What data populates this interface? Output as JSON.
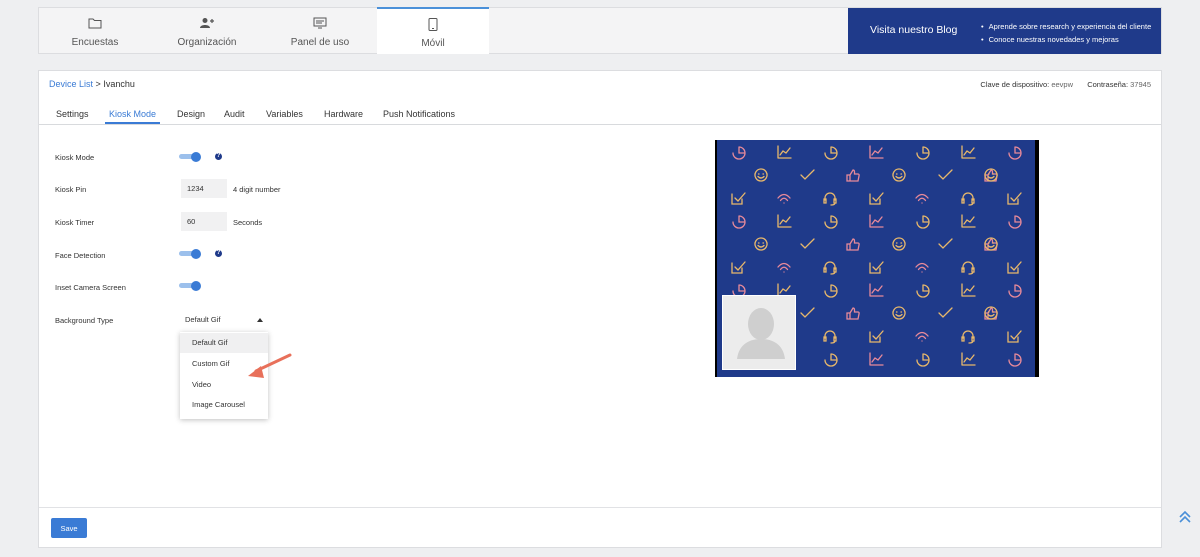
{
  "topnav": {
    "tabs": [
      {
        "label": "Encuestas",
        "icon": "folder-icon"
      },
      {
        "label": "Organización",
        "icon": "add-user-icon"
      },
      {
        "label": "Panel de uso",
        "icon": "dashboard-icon"
      },
      {
        "label": "Móvil",
        "icon": "mobile-icon",
        "active": true
      }
    ]
  },
  "blog": {
    "title": "Visita nuestro Blog",
    "bullets": [
      "Aprende sobre research y experiencia del cliente",
      "Conoce nuestras novedades y mejoras"
    ]
  },
  "breadcrumb": {
    "link": "Device List",
    "separator": ">",
    "current": "Ivanchu"
  },
  "credentials": {
    "device_key_label": "Clave de dispositivo:",
    "device_key_value": "eevpw",
    "password_label": "Contraseña:",
    "password_value": "37945"
  },
  "tabs": [
    "Settings",
    "Kiosk Mode",
    "Design",
    "Audit",
    "Variables",
    "Hardware",
    "Push Notifications"
  ],
  "active_tab": "Kiosk Mode",
  "form": {
    "kiosk_mode_label": "Kiosk Mode",
    "kiosk_mode_on": true,
    "kiosk_pin_label": "Kiosk Pin",
    "kiosk_pin_value": "1234",
    "kiosk_pin_hint": "4 digit number",
    "kiosk_timer_label": "Kiosk Timer",
    "kiosk_timer_value": "60",
    "kiosk_timer_hint": "Seconds",
    "face_detection_label": "Face Detection",
    "face_detection_on": true,
    "inset_camera_label": "Inset Camera Screen",
    "inset_camera_on": true,
    "background_type_label": "Background Type",
    "background_type_value": "Default Gif",
    "help_glyph": "?"
  },
  "dropdown": {
    "options": [
      "Default Gif",
      "Custom Gif",
      "Video",
      "Image Carousel"
    ],
    "highlighted": "Default Gif"
  },
  "save_label": "Save",
  "colors": {
    "accent": "#3a7bd5",
    "brand_navy": "#1f3a8a",
    "pattern_bg": "#1f3a8a",
    "pattern_icon_gold": "#e8b86b",
    "pattern_icon_pink": "#e88a9a",
    "annotation_arrow": "#e8705a"
  }
}
